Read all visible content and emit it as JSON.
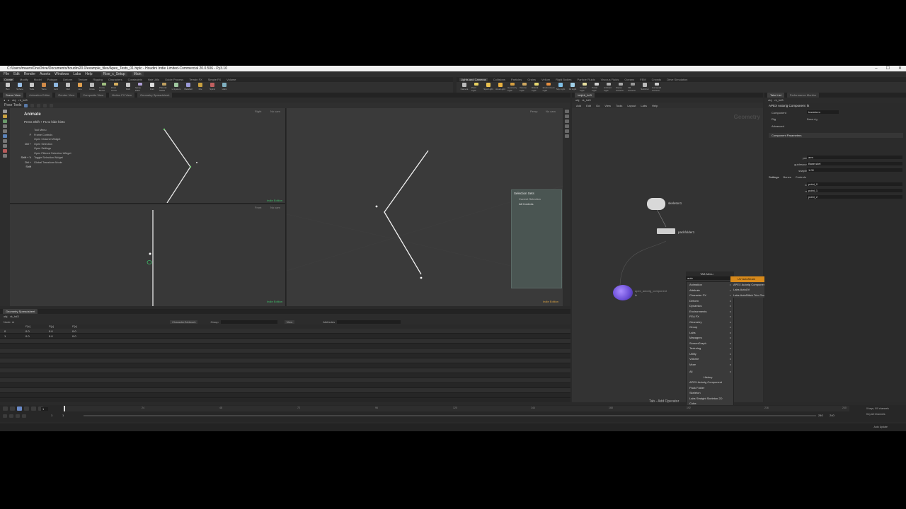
{
  "window": {
    "title": "C:/Users/mauro/OneDrive/Documents/houdini20.0/example_files/Apex_Tests_01.hiplc - Houdini Indie Limited-Commercial 20.0.506 - Py3.10",
    "controls": [
      "–",
      "☐",
      "✕"
    ]
  },
  "menubar": [
    "File",
    "Edit",
    "Render",
    "Assets",
    "Windows",
    "Labs",
    "Help"
  ],
  "desktop": {
    "name": "Rise_c_Setup",
    "context": "Main"
  },
  "shelf_tabs_left": [
    "Create",
    "Modify",
    "Model",
    "Polygon",
    "Deform",
    "Texture",
    "Rigging",
    "Characters",
    "Constraints",
    "Hair Utils",
    "Guide Process",
    "Terrain FX",
    "Simple FX",
    "Volume"
  ],
  "shelf_tabs_right": [
    "Lights and Cameras",
    "Collisions",
    "Particles",
    "Grains",
    "Vellum",
    "Rigid Bodies",
    "Particle Fluids",
    "Viscous Fluids",
    "Oceans",
    "FEM",
    "Crowds",
    "Drive Simulation"
  ],
  "shelf_tools_left": [
    "Box",
    "Sphere",
    "Tube",
    "Torus",
    "Grid",
    "Null",
    "Line",
    "Circle",
    "Curve Bezier",
    "Draw Curve",
    "Path",
    "Spray Paint",
    "Font",
    "Platonic Solids",
    "L-System",
    "Metaball",
    "File",
    "Spiral",
    "Helix"
  ],
  "shelf_tools_right": [
    "Camera",
    "Point Light",
    "Spot Light",
    "Area Light",
    "Geometry Light",
    "Volume Light",
    "Distant Light",
    "Environment Light",
    "Sky Light",
    "GI Light",
    "Caustic Light",
    "Portal Light",
    "Ambient Light",
    "Stereo Camera",
    "VR Camera",
    "Switcher",
    "Gamepad Camera"
  ],
  "scene_tabs": [
    "Scene View",
    "Animation Editor",
    "Render View",
    "Composite View",
    "Motion FX View",
    "Geometry Spreadsheet"
  ],
  "path": {
    "context": "obj",
    "node": "rk_hd3"
  },
  "pose_tools_label": "Pose Tools",
  "animate": {
    "title": "Animate",
    "hint": "Press Shift + F1 to hide hints",
    "hotkeys": [
      {
        "key": "",
        "label": "Tool Menu"
      },
      {
        "key": "F",
        "label": "Frame Controls"
      },
      {
        "key": "",
        "label": "Open Channel Widget"
      },
      {
        "key": "Ctrl +",
        "label": "Open Selection"
      },
      {
        "key": "",
        "label": "Open Settings"
      },
      {
        "key": "",
        "label": "Open Filtered Selection Widget"
      },
      {
        "key": "Shift + V",
        "label": "Toggle Selection Widget"
      },
      {
        "key": "Ctrl + Shift",
        "label": "Global Transform Mode"
      }
    ]
  },
  "viewports": {
    "top_left": {
      "view": "Right",
      "cam": "No cam"
    },
    "bottom_left": {
      "view": "Front",
      "cam": "No cam"
    },
    "main": {
      "view": "Persp",
      "cam": "No cam"
    },
    "indie_label": "Indie Edition"
  },
  "selection_sets": {
    "title": "Selection Sets",
    "items": [
      "Current Selection",
      "All Controls"
    ]
  },
  "spreadsheet": {
    "tab": "Geometry Spreadsheet",
    "node_label": "Node: rk",
    "char_label": "Character/Network",
    "group_label": "Group",
    "view_label": "View",
    "attr_label": "Attributes",
    "columns": [
      "",
      "P[x]",
      "P[y]",
      "P[z]"
    ],
    "rows": [
      [
        "0",
        "0.0",
        "0.0",
        "0.0"
      ],
      [
        "1",
        "0.0",
        "0.0",
        "0.0"
      ]
    ]
  },
  "network": {
    "tab": "/obj/rk_hd3",
    "path": {
      "context": "obj",
      "node": "rk_hd3"
    },
    "menu": [
      "Add",
      "Edit",
      "Go",
      "View",
      "Tools",
      "Layout",
      "Labs",
      "Help"
    ],
    "context_label": "Geometry",
    "nodes": [
      {
        "name": "skeleton1"
      },
      {
        "name": "packfolder1"
      },
      {
        "name": "apex_autorig_component",
        "short": "ik"
      }
    ],
    "status": "Tab - Add Operator"
  },
  "tab_menu": {
    "title": "TAB Menu",
    "search": "auto",
    "categories": [
      "Animation",
      "Attribute",
      "Character FX",
      "Deform",
      "Dynamics",
      "Environments",
      "FEA FX",
      "Geometry",
      "Group",
      "Labs",
      "Managers",
      "ScreenGraph",
      "Texturing",
      "Utility",
      "Volume",
      "More"
    ],
    "all_label": "All",
    "history_label": "History",
    "history": [
      "APEX Autorig Component",
      "Pack Folder",
      "Skeleton",
      "Labs Straight Skeleton 2D",
      "Cube",
      "Attribute Wrangle"
    ],
    "results": [
      "UV AutoSeam",
      "APEX Autorig Component",
      "Labs AutoUV",
      "Labs AutoStitch Trim Texture"
    ]
  },
  "params": {
    "tabs": [
      "Take List",
      "Performance Monitor"
    ],
    "path": {
      "context": "obj",
      "node": "rk_hd3"
    },
    "node_type": "APEX Autorig Component",
    "node_name": "ik",
    "component_label": "Component",
    "component_value": "transform",
    "rig_label": "Rig",
    "rig_value": "Base.rig",
    "advanced_label": "Advanced",
    "section": "Component Parameters",
    "fields": [
      {
        "label": "prefix",
        "value": "arm"
      },
      {
        "label": "guidesource",
        "value": "Base.skel"
      },
      {
        "label": "snaplimit",
        "value": "1.00"
      }
    ],
    "subtabs": [
      "Settings",
      "Bones",
      "Controls"
    ],
    "bones": [
      {
        "label": "root",
        "value": "point_0"
      },
      {
        "label": "mid",
        "value": "point_1"
      },
      {
        "label": "tip",
        "value": "point_2"
      }
    ]
  },
  "timeline": {
    "frame": "1",
    "start": "1",
    "end": "1",
    "range_end": "240",
    "range_end2": "240",
    "ticks": [
      "1",
      "24",
      "48",
      "72",
      "96",
      "120",
      "144",
      "168",
      "192",
      "216",
      "240"
    ],
    "keys_label": "0 keys, 0/0 channels",
    "all_channels": "Key All Channels",
    "auto_update": "Auto Update"
  },
  "colors": {
    "accent_orange": "#d88a1b",
    "green_label": "#3fbf6a",
    "viewport_bg": "#383838"
  }
}
